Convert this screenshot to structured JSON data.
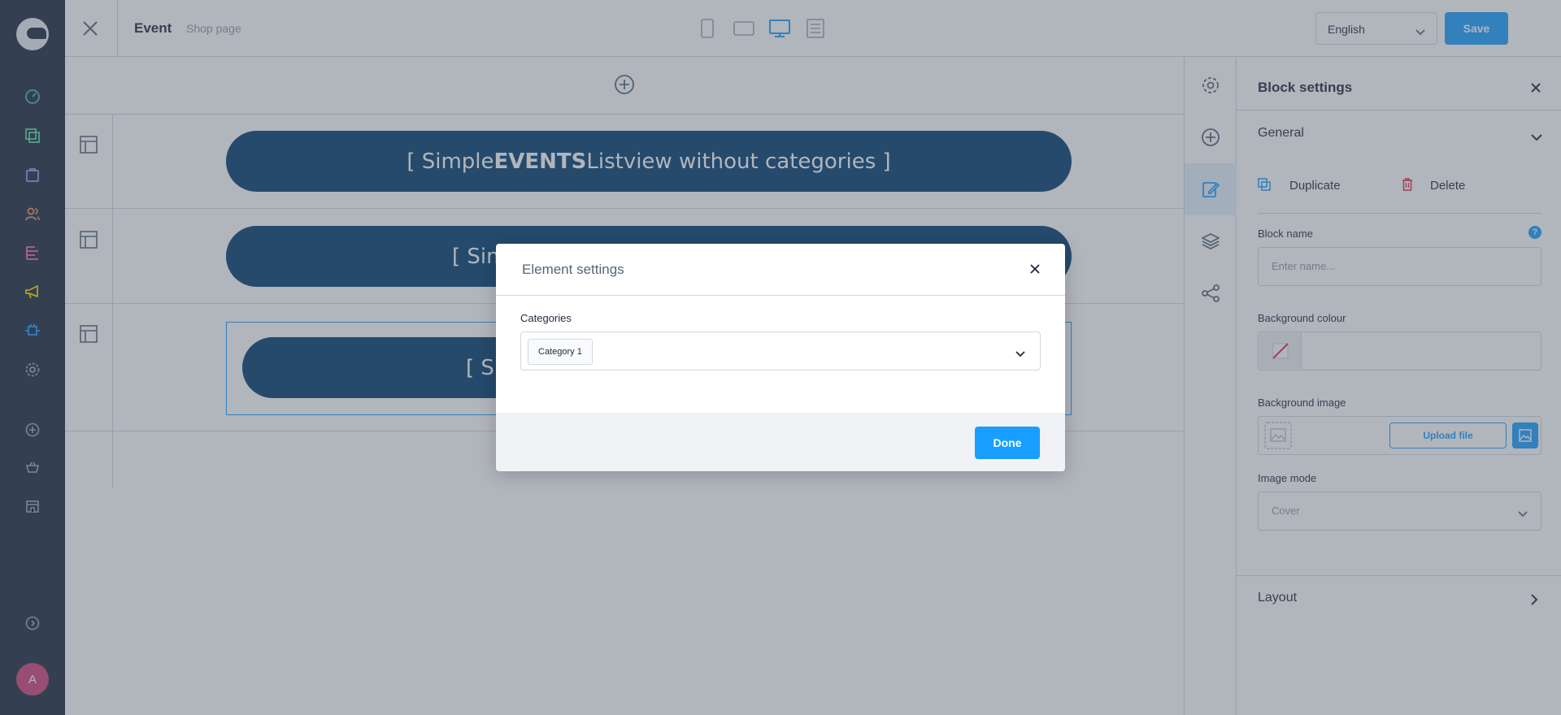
{
  "topbar": {
    "title": "Event",
    "subtitle": "Shop page",
    "language": "English",
    "save_label": "Save"
  },
  "sidebar": {
    "avatar_initial": "A",
    "items": [
      {
        "name": "dashboard-icon",
        "color": "#44b4c4"
      },
      {
        "name": "catalogues-icon",
        "color": "#57d9a3"
      },
      {
        "name": "orders-icon",
        "color": "#a092f0"
      },
      {
        "name": "customers-icon",
        "color": "#f88962"
      },
      {
        "name": "content-icon",
        "color": "#ff68b4"
      },
      {
        "name": "marketing-icon",
        "color": "#ffd700"
      },
      {
        "name": "extensions-icon",
        "color": "#189eff"
      },
      {
        "name": "settings-icon",
        "color": "#9aa8b5"
      },
      {
        "name": "add-sales-channel-icon",
        "color": "#9aa8b5"
      },
      {
        "name": "storefront-icon",
        "color": "#9aa8b5"
      },
      {
        "name": "headless-icon",
        "color": "#9aa8b5"
      }
    ]
  },
  "canvas": {
    "blocks": [
      {
        "prefix": "[ Simple",
        "bold": "EVENTS",
        "suffix": " Listview without categories ]"
      },
      {
        "prefix": "[ Sim",
        "bold": "",
        "suffix": ""
      },
      {
        "prefix": "[ Si",
        "bold": "",
        "suffix": ""
      }
    ]
  },
  "panel": {
    "title": "Block settings",
    "general_label": "General",
    "duplicate_label": "Duplicate",
    "delete_label": "Delete",
    "block_name_label": "Block name",
    "block_name_placeholder": "Enter name...",
    "help_glyph": "?",
    "bg_colour_label": "Background colour",
    "bg_image_label": "Background image",
    "upload_label": "Upload file",
    "image_mode_label": "Image mode",
    "image_mode_value": "Cover",
    "layout_label": "Layout"
  },
  "modal": {
    "title": "Element settings",
    "categories_label": "Categories",
    "selected_category": "Category 1",
    "done_label": "Done"
  },
  "colors": {
    "accent": "#189eff",
    "block_bg": "#003d6e",
    "sidebar_bg": "#1d2a3c"
  }
}
